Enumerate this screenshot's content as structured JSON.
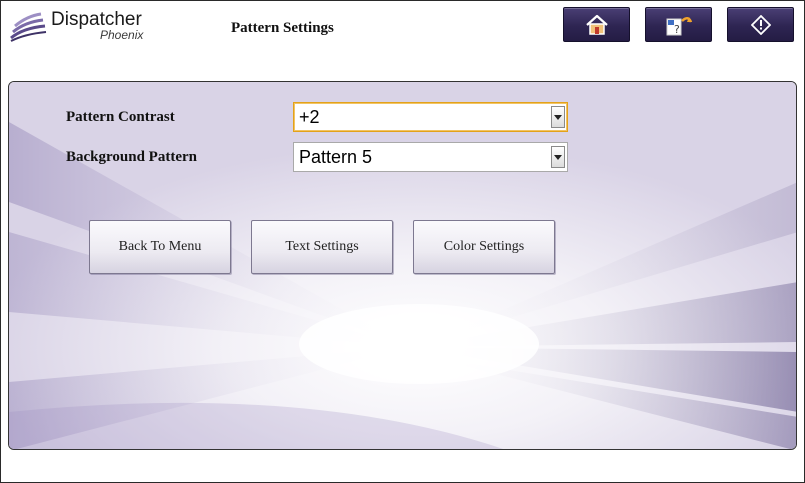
{
  "header": {
    "logo_title": "Dispatcher",
    "logo_subtitle": "Phoenix",
    "page_title": "Pattern Settings",
    "buttons": [
      {
        "icon": "home-icon"
      },
      {
        "icon": "language-icon"
      },
      {
        "icon": "info-icon"
      }
    ]
  },
  "form": {
    "pattern_contrast": {
      "label": "Pattern Contrast",
      "value": "+2"
    },
    "background_pattern": {
      "label": "Background Pattern",
      "value": "Pattern 5"
    }
  },
  "actions": {
    "back_to_menu": "Back To Menu",
    "text_settings": "Text Settings",
    "color_settings": "Color Settings"
  },
  "colors": {
    "header_button": "#2e2552",
    "focus_border": "#e3a21a",
    "accent_purple": "#5a4a8a"
  }
}
